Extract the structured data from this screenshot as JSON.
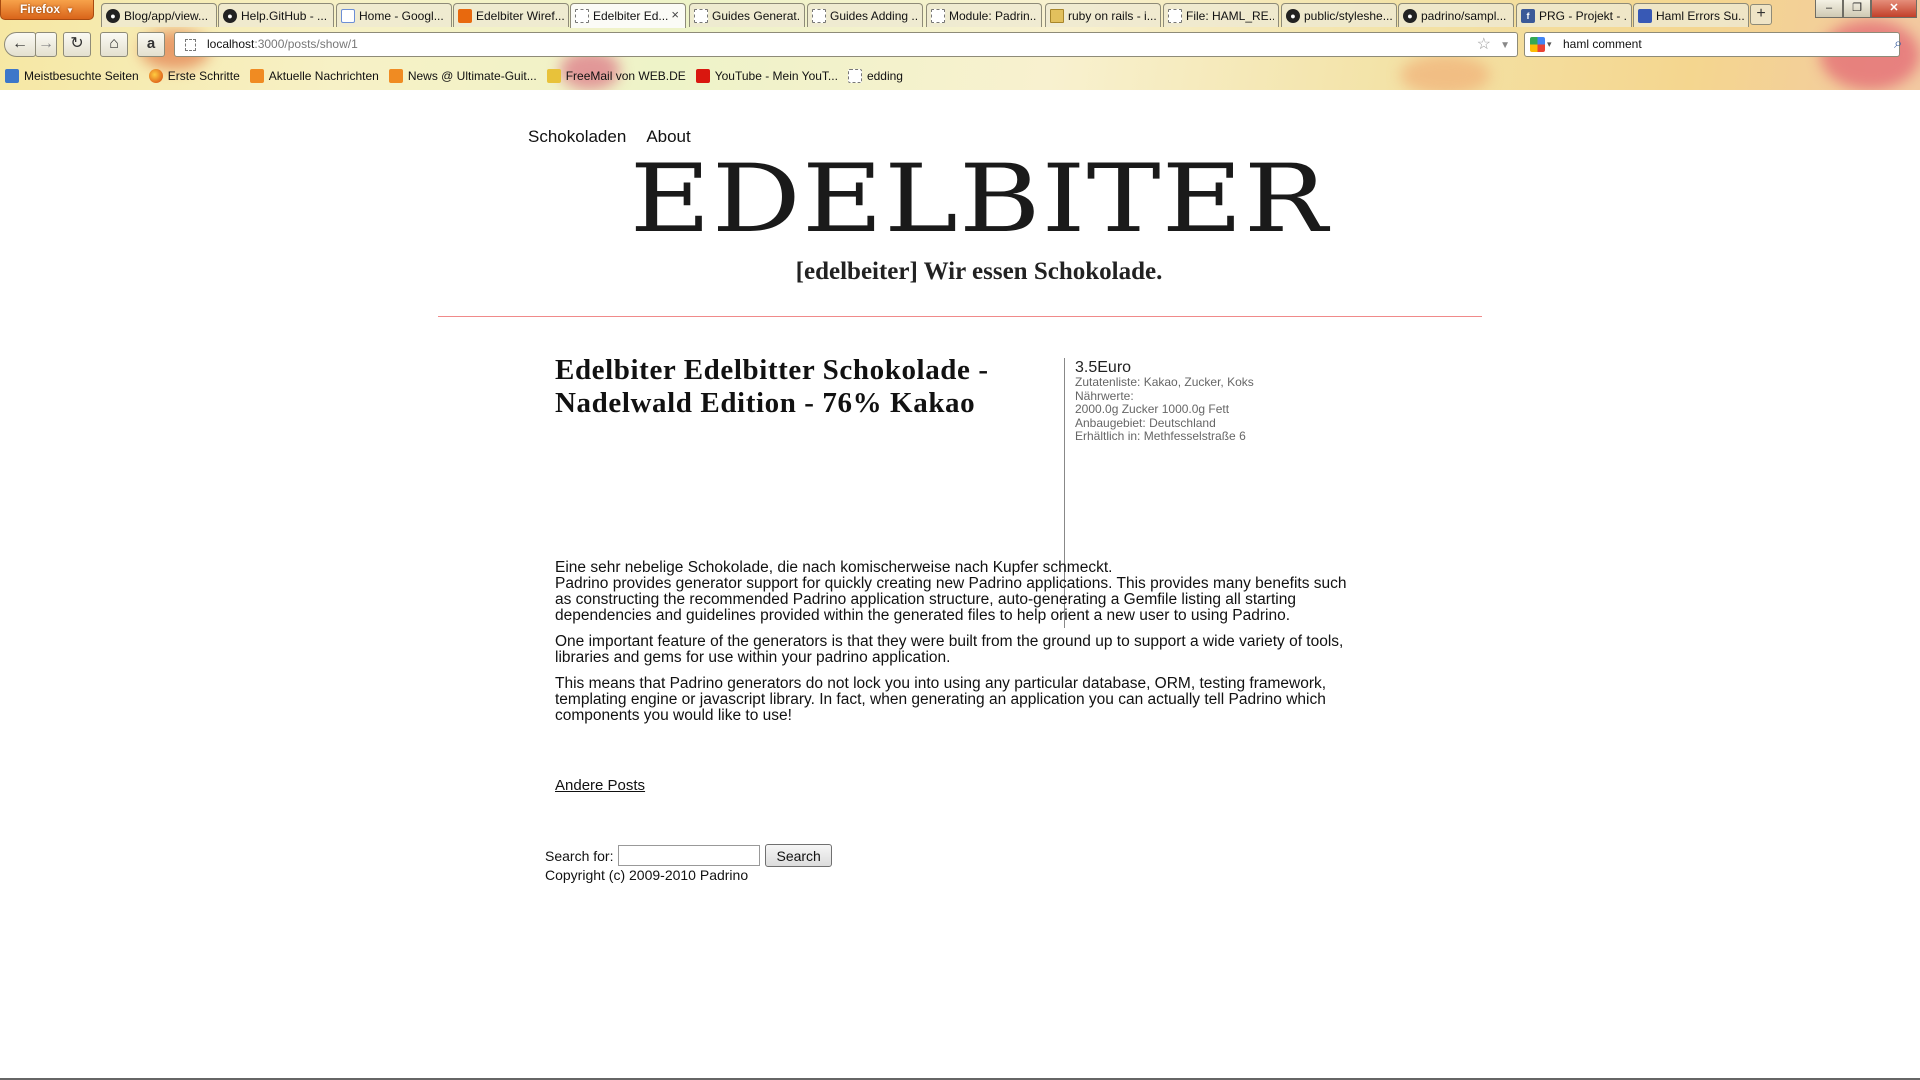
{
  "browser": {
    "menu_label": "Firefox",
    "tabs": [
      {
        "label": "Blog/app/view...",
        "icon": "github-icon"
      },
      {
        "label": "Help.GitHub - ...",
        "icon": "github-icon"
      },
      {
        "label": "Home - Googl...",
        "icon": "google-sites-icon"
      },
      {
        "label": "Edelbiter Wiref...",
        "icon": "orange-page-icon"
      },
      {
        "label": "Edelbiter Ed...",
        "icon": "blank-page-icon",
        "active": true
      },
      {
        "label": "Guides Generat...",
        "icon": "blank-page-icon"
      },
      {
        "label": "Guides Adding ...",
        "icon": "blank-page-icon"
      },
      {
        "label": "Module: Padrin...",
        "icon": "blank-page-icon"
      },
      {
        "label": "ruby on rails - i...",
        "icon": "folder-icon"
      },
      {
        "label": "File: HAML_RE...",
        "icon": "blank-page-icon"
      },
      {
        "label": "public/styleshe...",
        "icon": "github-icon"
      },
      {
        "label": "padrino/sampl...",
        "icon": "github-icon"
      },
      {
        "label": "PRG - Projekt - ...",
        "icon": "facebook-icon"
      },
      {
        "label": "Haml Errors Su...",
        "icon": "haml-icon"
      }
    ],
    "close_symbol": "×",
    "new_tab_symbol": "+",
    "url": {
      "host": "localhost",
      "path": ":3000/posts/show/1"
    },
    "search_query": "haml comment",
    "bookmarks": [
      {
        "label": "Meistbesuchte Seiten",
        "icon": "bookmark-folder-icon"
      },
      {
        "label": "Erste Schritte",
        "icon": "firefox-icon"
      },
      {
        "label": "Aktuelle Nachrichten",
        "icon": "rss-icon"
      },
      {
        "label": "News @ Ultimate-Guit...",
        "icon": "rss-icon"
      },
      {
        "label": "FreeMail von WEB.DE",
        "icon": "webde-icon"
      },
      {
        "label": "YouTube - Mein YouT...",
        "icon": "youtube-icon"
      },
      {
        "label": "edding",
        "icon": "blank-page-icon"
      }
    ]
  },
  "site": {
    "nav": [
      "Schokoladen",
      "About"
    ],
    "title": "EDELBITER",
    "tagline": "[edelbeiter] Wir essen Schokolade."
  },
  "post": {
    "title": "Edelbiter Edelbitter Schokolade - Nadelwald Edition - 76% Kakao",
    "price": "3.5Euro",
    "ingredients": "Zutatenliste: Kakao, Zucker, Koks",
    "nutrition_label": "Nährwerte:",
    "nutrition_values": "2000.0g Zucker 1000.0g Fett",
    "origin": "Anbaugebiet: Deutschland",
    "availability": "Erhältlich in: Methfesselstraße 6",
    "paragraphs": [
      "Eine sehr nebelige Schokolade, die nach komischerweise nach Kupfer schmeckt.",
      "Padrino provides generator support for quickly creating new Padrino applications. This provides many benefits such as constructing the recommended Padrino application structure, auto-generating a Gemfile listing all starting dependencies and guidelines provided within the generated files to help orient a new user to using Padrino.",
      "One important feature of the generators is that they were built from the ground up to support a wide variety of tools, libraries and gems for use within your padrino application.",
      "This means that Padrino generators do not lock you into using any particular database, ORM, testing framework, templating engine or javascript library. In fact, when generating an application you can actually tell Padrino which components you would like to use!"
    ],
    "other_posts_link": "Andere Posts"
  },
  "footer": {
    "search_label": "Search for:",
    "search_value": "",
    "search_button": "Search",
    "copyright": "Copyright (c) 2009-2010 Padrino"
  }
}
